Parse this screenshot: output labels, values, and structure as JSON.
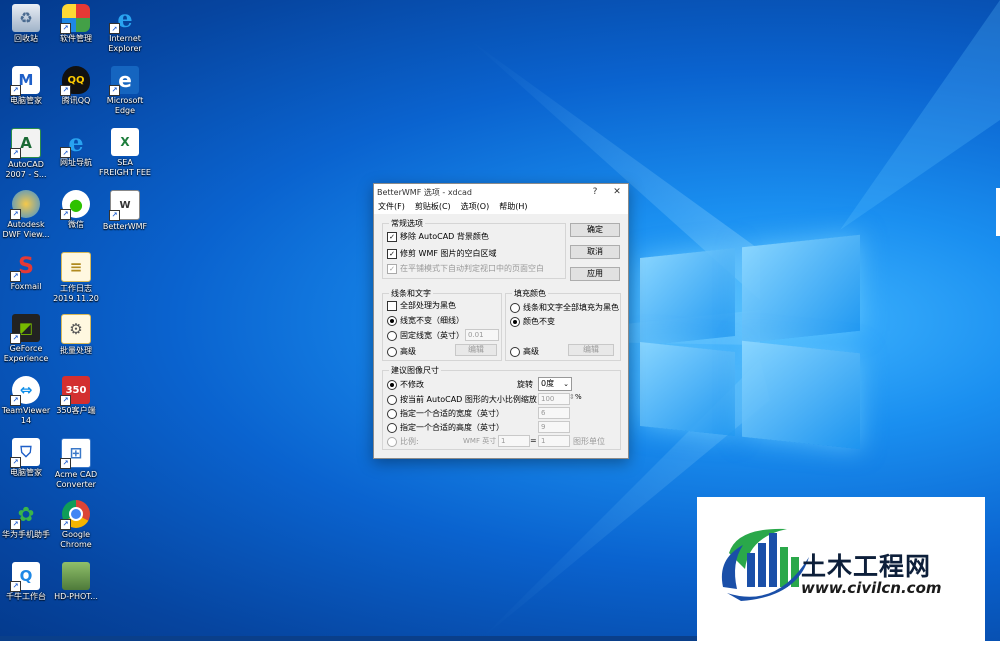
{
  "desktop": {
    "icons": [
      {
        "label": "回收站",
        "icon": "recycle-bin-icon"
      },
      {
        "label": "软件管理",
        "icon": "software-manager-icon"
      },
      {
        "label": "Internet\nExplorer",
        "icon": "ie-icon"
      },
      {
        "label": "电脑管家",
        "icon": "pc-manager-icon"
      },
      {
        "label": "腾讯QQ",
        "icon": "qq-icon"
      },
      {
        "label": "Microsoft\nEdge",
        "icon": "edge-icon"
      },
      {
        "label": "AutoCAD\n2007 - S...",
        "icon": "autocad-icon"
      },
      {
        "label": "网址导航",
        "icon": "web-nav-icon"
      },
      {
        "label": "SEA\nFREIGHT FEE",
        "icon": "excel-file-icon"
      },
      {
        "label": "Autodesk\nDWF View...",
        "icon": "dwf-viewer-icon"
      },
      {
        "label": "微信",
        "icon": "wechat-icon"
      },
      {
        "label": "BetterWMF",
        "icon": "betterwmf-icon"
      },
      {
        "label": "Foxmail",
        "icon": "foxmail-icon"
      },
      {
        "label": "工作日志\n2019.11.20",
        "icon": "text-file-icon"
      },
      {
        "label": "GeForce\nExperience",
        "icon": "geforce-icon"
      },
      {
        "label": "批量处理",
        "icon": "batch-file-icon"
      },
      {
        "label": "TeamViewer\n14",
        "icon": "teamviewer-icon"
      },
      {
        "label": "350客户端",
        "icon": "app-350-icon"
      },
      {
        "label": "电脑管家",
        "icon": "pc-manager-icon"
      },
      {
        "label": "Acme CAD\nConverter",
        "icon": "acme-cad-icon"
      },
      {
        "label": "华为手机助手",
        "icon": "huawei-assistant-icon"
      },
      {
        "label": "Google\nChrome",
        "icon": "chrome-icon"
      },
      {
        "label": "千牛工作台",
        "icon": "qianniu-icon"
      },
      {
        "label": "HD-PHOT...",
        "icon": "photo-file-icon"
      }
    ]
  },
  "dialog": {
    "title": "BetterWMF 选项 - xdcad",
    "help": "?",
    "close": "✕",
    "menu": [
      "文件(F)",
      "剪贴板(C)",
      "选项(O)",
      "帮助(H)"
    ],
    "general": {
      "title": "常规选项",
      "opt_remove_bg": "移除 AutoCAD 背景颜色",
      "opt_trim": "修剪 WMF 图片的空白区域",
      "opt_paper": "在平铺模式下自动判定视口中的页面空白"
    },
    "buttons": {
      "ok": "确定",
      "cancel": "取消",
      "apply": "应用"
    },
    "lines": {
      "title": "线条和文字",
      "all_black": "全部处理为黑色",
      "keep_width": "线宽不变（细线）",
      "fixed_width": "固定线宽（英寸）",
      "fixed_value": "0.01",
      "advanced": "高级",
      "edit": "编辑"
    },
    "fill": {
      "title": "填充颜色",
      "all_black": "线条和文字全部填充为黑色",
      "keep": "颜色不变",
      "advanced": "高级",
      "edit": "编辑"
    },
    "size": {
      "title": "建议图像尺寸",
      "no_change": "不修改",
      "rotate_label": "旋转",
      "rotate_value": "0度",
      "scale_by_autocad": "按当前 AutoCAD 图形的大小比例缩放",
      "scale_value": "100",
      "percent": "%",
      "width": "指定一个合适的宽度（英寸）",
      "width_value": "6",
      "height": "指定一个合适的高度（英寸）",
      "height_value": "9",
      "ratio": "比例:",
      "wmf_inch": "WMF 英寸",
      "ratio_left": "1",
      "equals": "=",
      "ratio_right": "1",
      "drawing_unit": "图形单位"
    }
  },
  "watermark": {
    "name": "土木工程网",
    "url": "www.civilcn.com"
  },
  "colors": {
    "desktop_blue": "#0a63cf",
    "logo_blue": "#1a4fa8",
    "logo_green": "#2aa84a"
  }
}
